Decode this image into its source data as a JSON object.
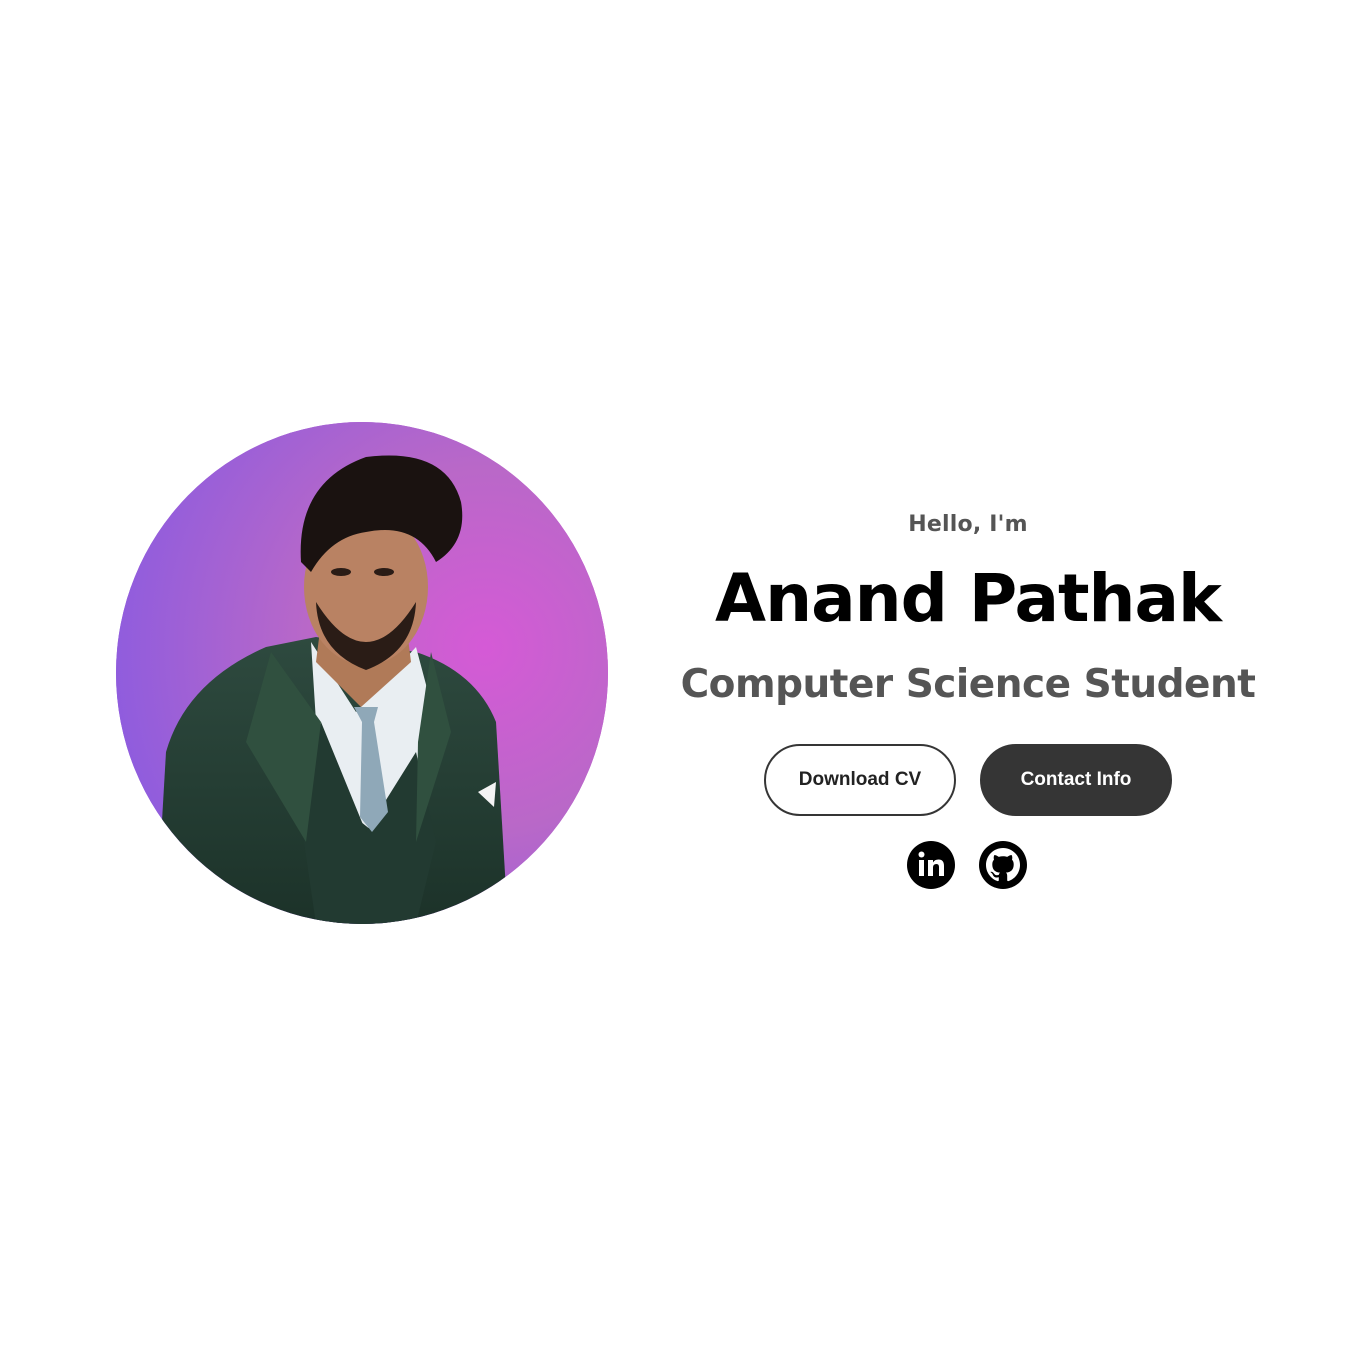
{
  "hero": {
    "greeting": "Hello, I'm",
    "name": "Anand Pathak",
    "role": "Computer Science Student",
    "profile_image_alt": "Anand Pathak profile picture"
  },
  "buttons": {
    "download_cv_label": "Download CV",
    "contact_info_label": "Contact Info"
  },
  "socials": [
    {
      "icon": "linkedin-icon",
      "label": "LinkedIn"
    },
    {
      "icon": "github-icon",
      "label": "GitHub"
    }
  ],
  "colors": {
    "text_primary": "#000000",
    "text_secondary": "#555555",
    "button_dark": "#353535",
    "avatar_gradient": [
      "#8a58e0",
      "#d65ed8"
    ]
  }
}
